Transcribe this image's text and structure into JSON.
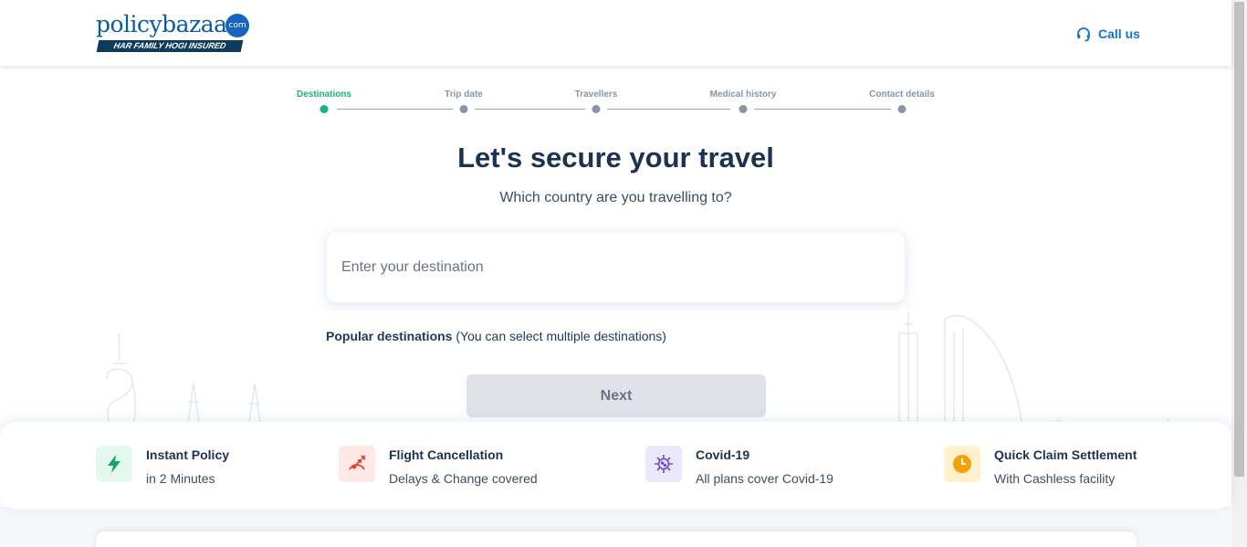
{
  "header": {
    "logo_text_a": "policy",
    "logo_text_b": "bazaar",
    "logo_com": "com",
    "logo_tagline": "HAR FAMILY HOGI INSURED",
    "call_us_label": "Call us",
    "call_icon": "headset-icon"
  },
  "stepper": {
    "steps": [
      {
        "label": "Destinations",
        "active": true
      },
      {
        "label": "Trip date",
        "active": false
      },
      {
        "label": "Travellers",
        "active": false
      },
      {
        "label": "Medical history",
        "active": false
      },
      {
        "label": "Contact details",
        "active": false
      }
    ],
    "active_color": "#17b37f"
  },
  "main": {
    "title": "Let's secure your travel",
    "subtitle": "Which country are you travelling to?",
    "destination_placeholder": "Enter your destination",
    "destination_value": "",
    "popular_label": "Popular destinations",
    "popular_note": "(You can select multiple destinations)",
    "next_label": "Next"
  },
  "features": [
    {
      "title": "Instant Policy",
      "subtitle": "in 2 Minutes",
      "icon": "lightning-icon",
      "bg": "#e3f8ef",
      "color": "#10a36b"
    },
    {
      "title": "Flight Cancellation",
      "subtitle": "Delays & Change covered",
      "icon": "flight-cancel-icon",
      "bg": "#fde8e6",
      "color": "#e0432f"
    },
    {
      "title": "Covid-19",
      "subtitle": "All plans cover Covid-19",
      "icon": "virus-icon",
      "bg": "#ece8fb",
      "color": "#6a4fc9"
    },
    {
      "title": "Quick Claim Settlement",
      "subtitle": "With Cashless facility",
      "icon": "clock-icon",
      "bg": "#fff1cc",
      "color": "#f5a10c"
    }
  ]
}
